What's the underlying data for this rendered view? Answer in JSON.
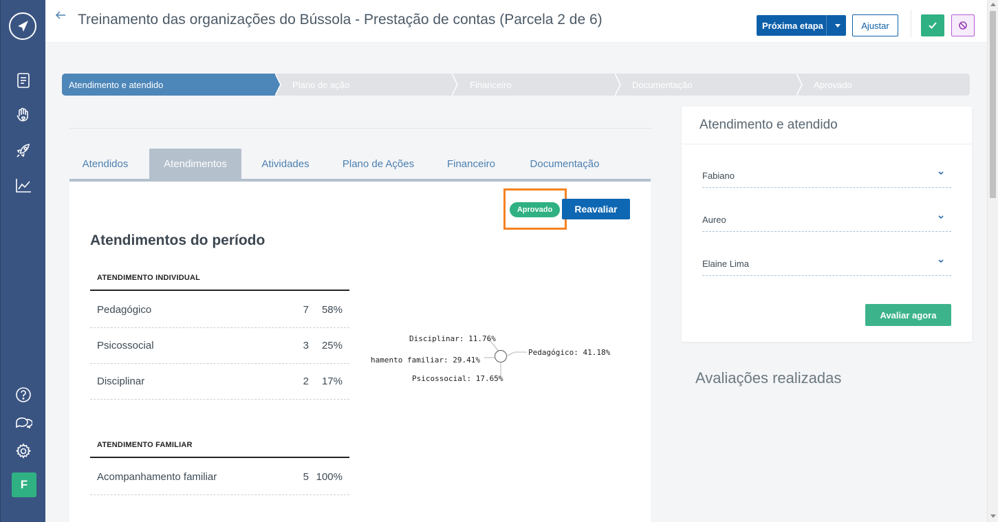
{
  "header": {
    "title": "Treinamento das organizações do Bússola - Prestação de contas (Parcela 2 de 6)",
    "next_step_label": "Próxima etapa",
    "adjust_label": "Ajustar"
  },
  "sidebar": {
    "items": [
      {
        "icon": "document-icon"
      },
      {
        "icon": "hand-heart-icon"
      },
      {
        "icon": "rocket-icon"
      },
      {
        "icon": "chart-trend-icon"
      },
      {
        "icon": "help-icon"
      },
      {
        "icon": "chat-icon"
      },
      {
        "icon": "settings-icon"
      }
    ],
    "avatar_initial": "F"
  },
  "steps": [
    "Atendimento e atendido",
    "Plano de ação",
    "Financeiro",
    "Documentação",
    "Aprovado"
  ],
  "tabs": [
    "Atendidos",
    "Atendimentos",
    "Atividades",
    "Plano de Ações",
    "Financeiro",
    "Documentação"
  ],
  "status": {
    "badge": "Aprovado",
    "reevaluate_label": "Reavaliar"
  },
  "main": {
    "section_title": "Atendimentos do período",
    "individual": {
      "header": "ATENDIMENTO INDIVIDUAL",
      "rows": [
        {
          "label": "Pedagógico",
          "count": "7",
          "pct": "58%"
        },
        {
          "label": "Psicossocial",
          "count": "3",
          "pct": "25%"
        },
        {
          "label": "Disciplinar",
          "count": "2",
          "pct": "17%"
        }
      ]
    },
    "familiar": {
      "header": "ATENDIMENTO FAMILIAR",
      "rows": [
        {
          "label": "Acompanhamento familiar",
          "count": "5",
          "pct": "100%"
        }
      ]
    }
  },
  "pie_labels": {
    "disciplinar": "Disciplinar: 11.76%",
    "familiar": "hamento familiar: 29.41%",
    "psicossocial": "Psicossocial: 17.65%",
    "pedagogico": "Pedagógico: 41.18%"
  },
  "right_panel": {
    "title": "Atendimento e atendido",
    "selects": [
      "Fabiano",
      "Aureo",
      "Elaine Lima"
    ],
    "evaluate_now_label": "Avaliar agora",
    "evaluations_title": "Avaliações realizadas"
  },
  "colors": {
    "sidebar": "#3a5482",
    "primary": "#0e5fa9",
    "success": "#2fb183",
    "step_active": "#4d86b9",
    "highlight": "#f58220"
  }
}
